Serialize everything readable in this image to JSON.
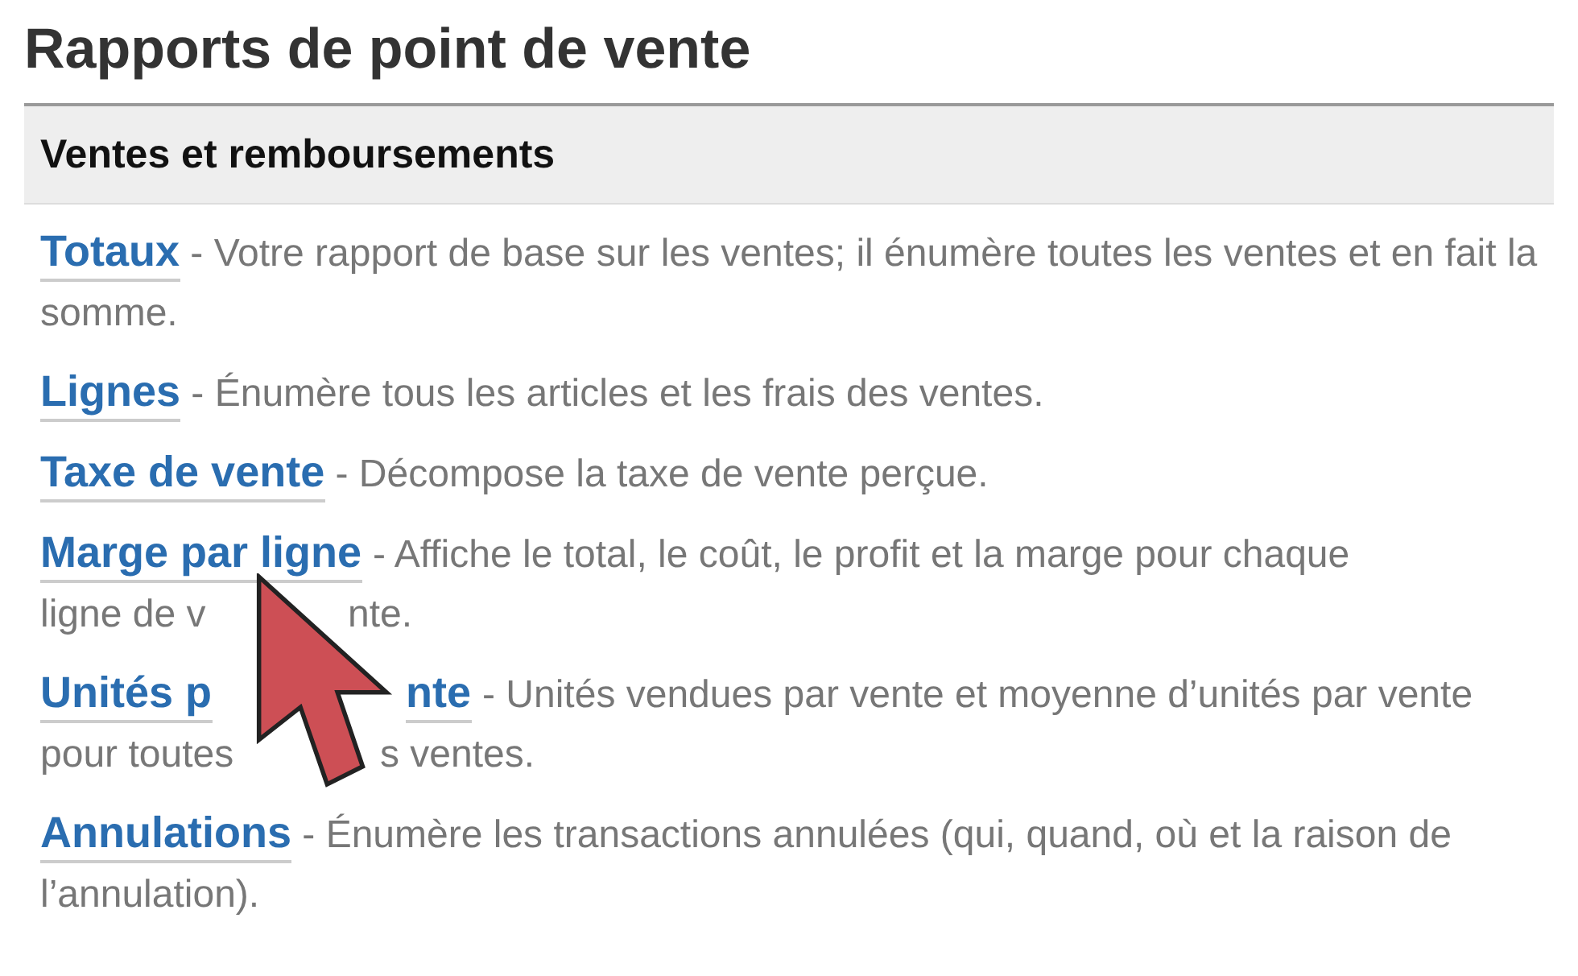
{
  "title": "Rapports de point de vente",
  "section": {
    "heading": "Ventes et remboursements",
    "reports": [
      {
        "kind": "plain",
        "link": "Totaux",
        "description": "- Votre rapport de base sur les ventes; il énumère toutes les ventes et en fait la somme."
      },
      {
        "kind": "plain",
        "link": "Lignes",
        "description": "- Énumère tous les articles et les frais des ventes."
      },
      {
        "kind": "plain",
        "link": "Taxe de vente",
        "description": "- Décompose la taxe de vente perçue."
      },
      {
        "kind": "split",
        "lines": [
          [
            {
              "kind": "link",
              "text": "Marge par ligne"
            },
            {
              "kind": "text",
              "text": "- Affiche le total, le coût, le profit et la marge pour chaque"
            }
          ],
          [
            {
              "kind": "text",
              "text": "ligne de v"
            },
            {
              "kind": "covered"
            },
            {
              "kind": "text",
              "text": "nte."
            }
          ]
        ]
      },
      {
        "kind": "split",
        "lines": [
          [
            {
              "kind": "link",
              "text": "Unités p"
            },
            {
              "kind": "covered"
            },
            {
              "kind": "link",
              "text": "nte"
            },
            {
              "kind": "text",
              "text": "- Unités vendues par vente et moyenne d’unités par vente"
            }
          ],
          [
            {
              "kind": "text",
              "text": "pour toutes"
            },
            {
              "kind": "covered"
            },
            {
              "kind": "text",
              "text": "s ventes."
            }
          ]
        ]
      },
      {
        "kind": "plain",
        "link": "Annulations",
        "description": "- Énumère les transactions annulées (qui, quand, où et la raison de l’annulation)."
      }
    ]
  }
}
